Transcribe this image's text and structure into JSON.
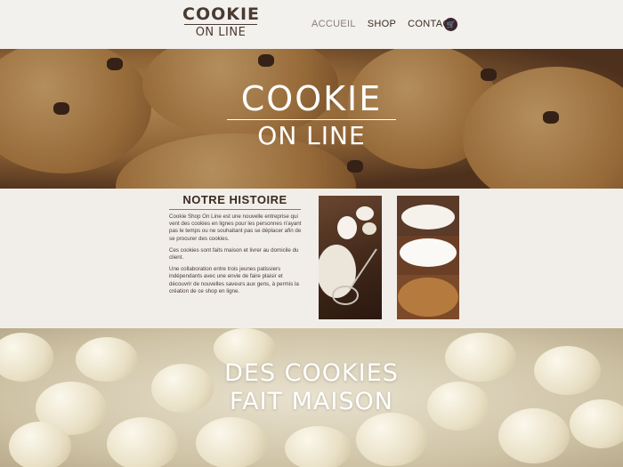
{
  "header": {
    "logo_line1": "COOKIE",
    "logo_line2": "ON LINE",
    "nav": [
      "ACCUEIL",
      "SHOP",
      "CONTACT"
    ],
    "active": "ACCUEIL"
  },
  "hero": {
    "logo_line1": "COOKIE",
    "logo_line2": "ON LINE"
  },
  "story": {
    "title": "NOTRE HISTOIRE",
    "paragraphs": [
      "Cookie Shop On Line est une nouvelle entreprise qui vent des cookies en lignes pour les personnes n'ayant pas le temps ou ne souhaitant pas se déplacer afin de se procurer des cookies.",
      "Ces cookies sont faits maison et livrer au domicile du client.",
      "Une collaboration entre trois jeunes patissiers indépendants avec une envie de faire plaisir et découvrir de nouvelles saveurs aux gens, à permis la création de ce shop en ligne."
    ]
  },
  "banner": {
    "line1": "DES COOKIES",
    "line2": "FAIT MAISON"
  },
  "colors": {
    "brand": "#4a3a30",
    "nav_active": "#8b7a84",
    "cart": "#3b2530"
  }
}
